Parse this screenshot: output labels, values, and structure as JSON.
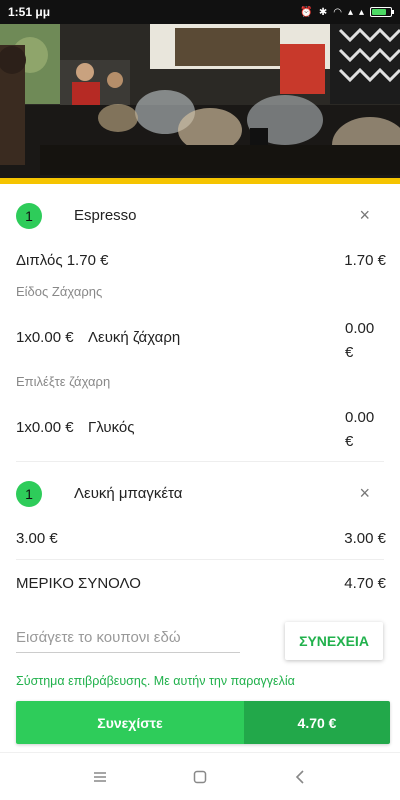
{
  "status_bar": {
    "time": "1:51 μμ"
  },
  "item1": {
    "qty": "1",
    "name": "Espresso",
    "close": "×",
    "option_label": "Διπλός 1.70 €",
    "option_price": "1.70 €",
    "group1_title": "Είδος Ζάχαρης",
    "group1_line_qty": "1x0.00 €",
    "group1_line_name": "Λευκή ζάχαρη",
    "group1_line_price": "0.00\n€",
    "group2_title": "Επιλέξτε ζάχαρη",
    "group2_line_qty": "1x0.00 €",
    "group2_line_name": "Γλυκός",
    "group2_line_price": "0.00\n€"
  },
  "item2": {
    "qty": "1",
    "name": "Λευκή μπαγκέτα",
    "close": "×",
    "unit_price": "3.00 €",
    "line_total": "3.00 €"
  },
  "subtotal": {
    "label": "ΜΕΡΙΚΟ ΣΥΝΟΛΟ",
    "value": "4.70 €"
  },
  "coupon": {
    "placeholder": "Εισάγετε το κουπονι εδώ",
    "button": "ΣΥΝΕΧΕΙΑ"
  },
  "reward_text": "Σύστημα επιβράβευσης. Με αυτήν την παραγγελία",
  "checkout": {
    "label": "Συνεχίστε",
    "total": "4.70 €"
  },
  "colors": {
    "accent": "#2ecc5a",
    "accent_dark": "#22a84a",
    "banner_stripe": "#f5c400"
  }
}
